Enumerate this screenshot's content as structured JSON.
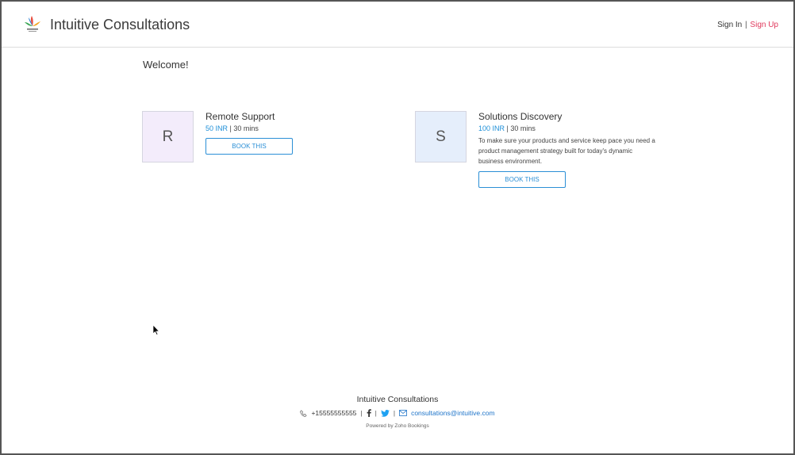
{
  "header": {
    "brand": "Intuitive Consultations",
    "sign_in": "Sign In",
    "separator": "|",
    "sign_up": "Sign Up"
  },
  "main": {
    "welcome": "Welcome!",
    "services": [
      {
        "initial": "R",
        "name": "Remote Support",
        "price": "50 INR",
        "meta_sep": "|",
        "duration": "30 mins",
        "description": "",
        "button": "BOOK THIS",
        "thumb_color": "#f3ecfb"
      },
      {
        "initial": "S",
        "name": "Solutions Discovery",
        "price": "100 INR",
        "meta_sep": "|",
        "duration": "30 mins",
        "description": "To make sure your products and service keep pace you need a product management strategy built for today's dynamic business environment.",
        "button": "BOOK THIS",
        "thumb_color": "#e5eefb"
      }
    ]
  },
  "footer": {
    "title": "Intuitive Consultations",
    "phone": "+15555555555",
    "sep": "|",
    "email": "consultations@intuitive.com",
    "powered_by": "Powered by Zoho Bookings",
    "icons": [
      "phone-icon",
      "facebook-icon",
      "twitter-icon",
      "mail-icon"
    ]
  },
  "colors": {
    "accent": "#1e8fd8",
    "signup": "#e0395c"
  }
}
